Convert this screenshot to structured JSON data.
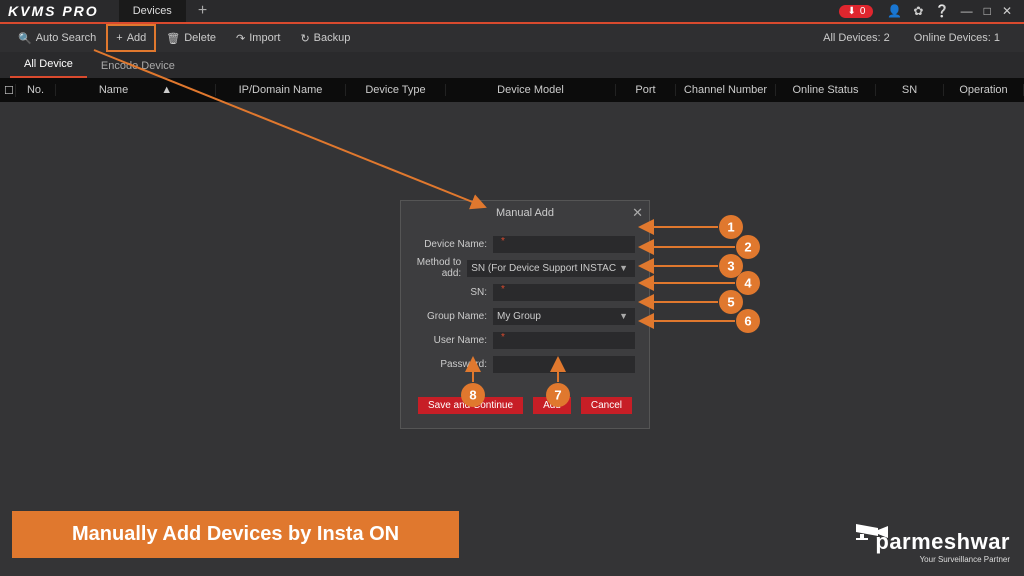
{
  "app": {
    "logo": "KVMS PRO"
  },
  "topTabs": {
    "devices": "Devices"
  },
  "titlebar": {
    "recBadge": "0"
  },
  "toolbar": {
    "autoSearch": "Auto Search",
    "add": "Add",
    "delete": "Delete",
    "import": "Import",
    "backup": "Backup",
    "allDevices": "All Devices:  2",
    "onlineDevices": "Online Devices:  1"
  },
  "subtabs": {
    "allDevice": "All Device",
    "encodeDevice": "Encode Device"
  },
  "columns": {
    "no": "No.",
    "name": "Name",
    "ip": "IP/Domain Name",
    "type": "Device Type",
    "model": "Device Model",
    "port": "Port",
    "channel": "Channel Number",
    "status": "Online Status",
    "sn": "SN",
    "op": "Operation"
  },
  "modal": {
    "title": "Manual Add",
    "fields": {
      "deviceName": "Device Name:",
      "methodToAdd": "Method to add:",
      "methodValue": "SN (For Device Support INSTAC",
      "sn": "SN:",
      "groupName": "Group Name:",
      "groupValue": "My Group",
      "userName": "User Name:",
      "password": "Password:"
    },
    "buttons": {
      "saveContinue": "Save and Continue",
      "add": "Add",
      "cancel": "Cancel"
    }
  },
  "annotations": {
    "1": "1",
    "2": "2",
    "3": "3",
    "4": "4",
    "5": "5",
    "6": "6",
    "7": "7",
    "8": "8"
  },
  "caption": "Manually Add Devices by Insta ON",
  "watermark": {
    "brand": "parmeshwar",
    "tag": "Your Surveillance Partner"
  }
}
